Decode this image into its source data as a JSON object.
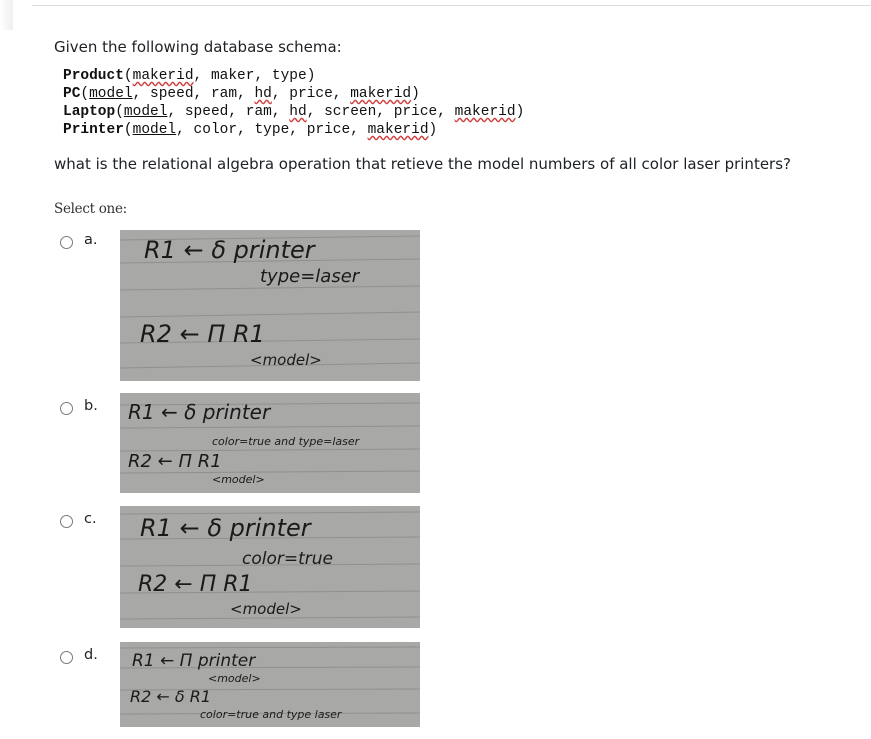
{
  "intro": "Given the following database schema:",
  "schema": [
    {
      "relation": "Product",
      "attrs": [
        {
          "name": "makerid",
          "key": true
        },
        {
          "name": "maker"
        },
        {
          "name": "type"
        }
      ]
    },
    {
      "relation": "PC",
      "attrs": [
        {
          "name": "model",
          "key": true
        },
        {
          "name": "speed"
        },
        {
          "name": "ram"
        },
        {
          "name": "hd",
          "spell": true
        },
        {
          "name": "price"
        },
        {
          "name": "makerid",
          "spell": true
        }
      ]
    },
    {
      "relation": "Laptop",
      "attrs": [
        {
          "name": "model",
          "key": true
        },
        {
          "name": "speed"
        },
        {
          "name": "ram"
        },
        {
          "name": "hd",
          "spell": true
        },
        {
          "name": "screen"
        },
        {
          "name": "price"
        },
        {
          "name": "makerid",
          "spell": true
        }
      ]
    },
    {
      "relation": "Printer",
      "attrs": [
        {
          "name": "model",
          "key": true
        },
        {
          "name": "color"
        },
        {
          "name": "type"
        },
        {
          "name": "price"
        },
        {
          "name": "makerid",
          "spell": true
        }
      ]
    }
  ],
  "question": "what is the relational algebra operation that retieve the model numbers of all color laser printers?",
  "select_label": "Select one:",
  "options": [
    {
      "label": "a.",
      "lines": [
        "R1 ← δ printer",
        "type=laser",
        "R2 ← Π R1",
        "<model>"
      ]
    },
    {
      "label": "b.",
      "lines": [
        "R1 ← δ printer",
        "color=true and type=laser",
        "R2 ← Π R1",
        "<model>"
      ]
    },
    {
      "label": "c.",
      "lines": [
        "R1 ← δ printer",
        "color=true",
        "R2 ← Π R1",
        "<model>"
      ]
    },
    {
      "label": "d.",
      "lines": [
        "R1 ← Π printer",
        "<model>",
        "R2 ← δ R1",
        "color=true and type laser"
      ]
    }
  ]
}
